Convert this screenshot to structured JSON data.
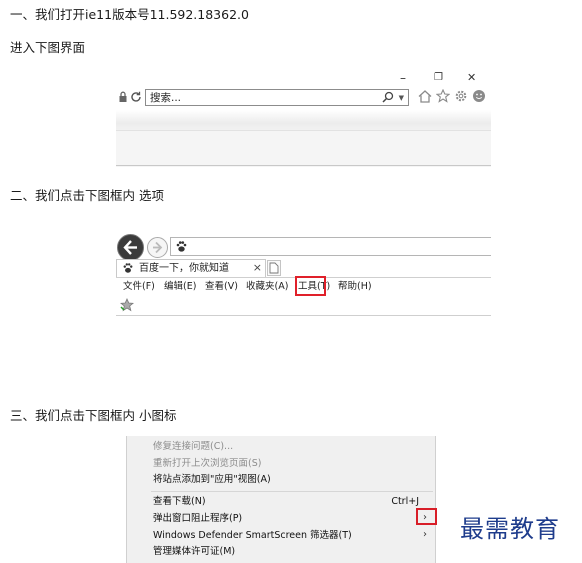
{
  "steps": [
    {
      "text": "一、我们打开ie11版本号11.592.18362.0"
    },
    {
      "text": "进入下图界面"
    },
    {
      "text": "二、我们点击下图框内 选项"
    },
    {
      "text": "三、我们点击下图框内 小图标"
    }
  ],
  "shot1": {
    "window_controls": {
      "minimize": "–",
      "maximize": "❐",
      "close": "✕"
    },
    "address_text": "搜索...",
    "icons": [
      "lock-icon",
      "refresh-icon",
      "search-icon",
      "dropdown-icon",
      "home-icon",
      "favorites-star-icon",
      "gear-icon",
      "smiley-icon"
    ]
  },
  "shot2": {
    "tab_title": "百度一下，你就知道",
    "tab_close": "×",
    "menu": [
      {
        "label": "文件(F)"
      },
      {
        "label": "编辑(E)"
      },
      {
        "label": "查看(V)"
      },
      {
        "label": "收藏夹(A)"
      },
      {
        "label": "工具(T)"
      },
      {
        "label": "帮助(H)"
      }
    ]
  },
  "shot3": {
    "items": [
      {
        "label": "修复连接问题(C)...",
        "enabled": false
      },
      {
        "label": "重新打开上次浏览页面(S)",
        "enabled": false
      },
      {
        "label": "将站点添加到\"应用\"视图(A)",
        "enabled": true
      },
      {
        "label": "查看下载(N)",
        "enabled": true,
        "shortcut": "Ctrl+J"
      },
      {
        "label": "弹出窗口阻止程序(P)",
        "enabled": true,
        "arrow": "›"
      },
      {
        "label": "Windows Defender SmartScreen 筛选器(T)",
        "enabled": true,
        "arrow": "›"
      },
      {
        "label": "管理媒体许可证(M)",
        "enabled": true
      }
    ]
  },
  "watermark": {
    "text": "最需教育"
  },
  "colors": {
    "highlight": "#e0202a",
    "watermark": "#1e3c8c"
  }
}
